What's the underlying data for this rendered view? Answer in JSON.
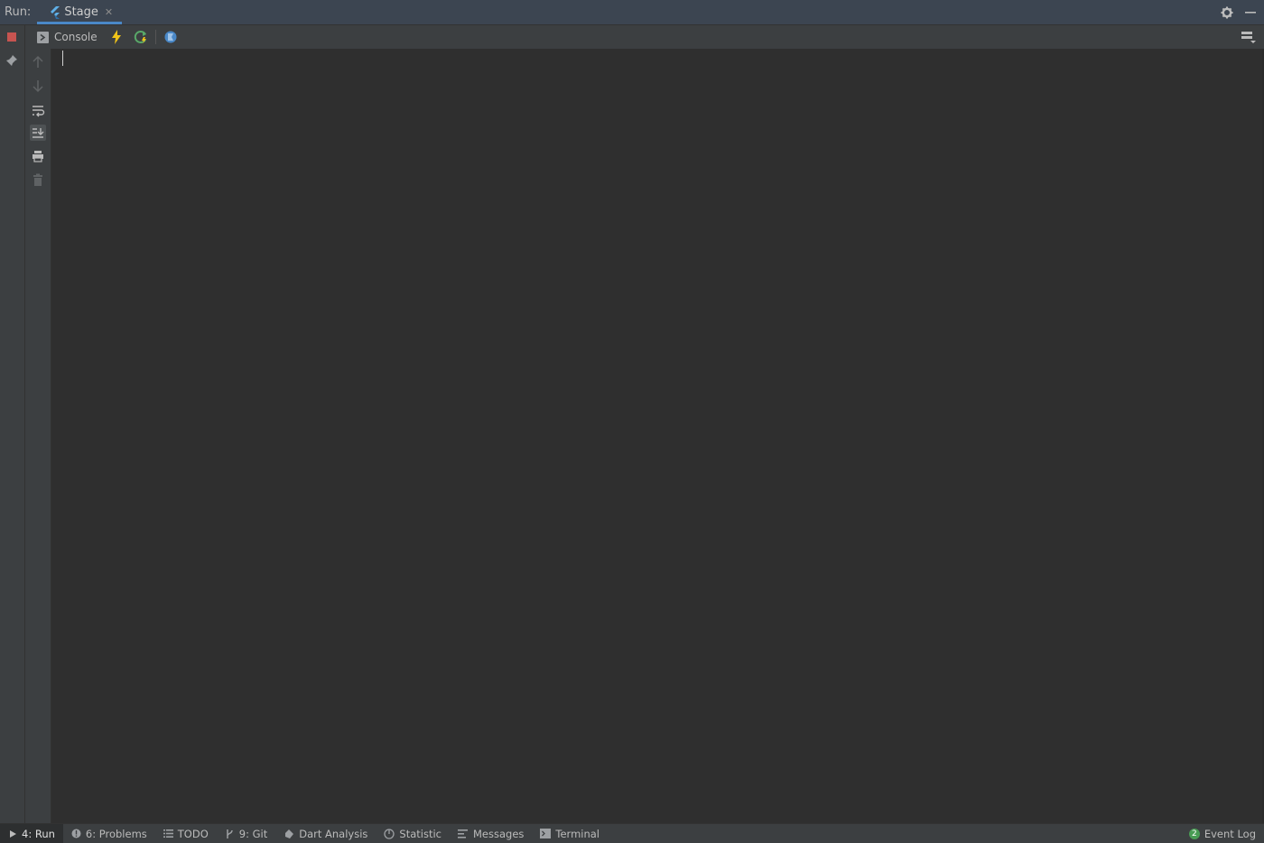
{
  "run_panel": {
    "label": "Run:",
    "tab": {
      "label": "Stage",
      "icon": "flutter-icon",
      "close_icon": "close-icon"
    }
  },
  "titlebar_icons": [
    "gear-icon",
    "minimize-icon"
  ],
  "toolbar": {
    "console_label": "Console",
    "buttons": [
      "hot-reload-icon",
      "hot-restart-icon",
      "devtools-icon"
    ],
    "right_icon": "layout-icon"
  },
  "rail_icons": [
    "stop-icon",
    "pin-icon"
  ],
  "vertical_tools": [
    "up-arrow-icon",
    "down-arrow-icon",
    "soft-wrap-icon",
    "scroll-to-end-icon",
    "print-icon",
    "trash-icon"
  ],
  "console": {
    "content": ""
  },
  "statusbar": {
    "items": [
      {
        "label": "4: Run",
        "icon": "play-icon",
        "active": true
      },
      {
        "label": "6: Problems",
        "icon": "info-icon"
      },
      {
        "label": "TODO",
        "icon": "list-icon"
      },
      {
        "label": "9: Git",
        "icon": "branch-icon"
      },
      {
        "label": "Dart Analysis",
        "icon": "dart-icon"
      },
      {
        "label": "Statistic",
        "icon": "pie-icon"
      },
      {
        "label": "Messages",
        "icon": "messages-icon"
      },
      {
        "label": "Terminal",
        "icon": "terminal-icon"
      }
    ],
    "event_log": {
      "label": "Event Log",
      "count": "2"
    }
  },
  "colors": {
    "accent": "#4a88c7",
    "stop_red": "#c75450",
    "bolt_yellow": "#f0c419",
    "restart_green": "#59a869",
    "badge_green": "#499c54"
  }
}
